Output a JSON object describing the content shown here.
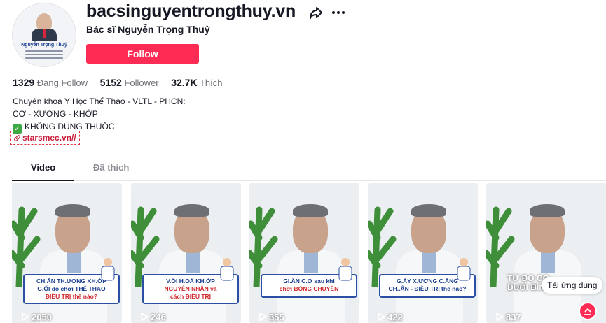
{
  "profile": {
    "username": "bacsinguyentrongthuy.vn",
    "nickname": "Bác sĩ Nguyễn Trọng Thuỷ",
    "follow_label": "Follow",
    "avatar_text": "Nguyễn Trọng Thuỷ"
  },
  "stats": {
    "following_count": "1329",
    "following_label": "Đang Follow",
    "followers_count": "5152",
    "followers_label": "Follower",
    "likes_count": "32.7K",
    "likes_label": "Thích"
  },
  "bio": {
    "line1": "Chuyên khoa Y Học Thể Thao - VLTL - PHCN:",
    "line2": "CƠ - XƯƠNG - KHỚP",
    "line3": "KHÔNG DÙNG THUỐC",
    "link": "starsmec.vn//"
  },
  "tabs": {
    "video": "Video",
    "liked": "Đã thích"
  },
  "videos": [
    {
      "cap1": "CH.ẤN TH.ƯƠNG KH.ỚP",
      "cap2": "G.ỐI do chơi THỂ THAO",
      "cap3": "ĐIỀU TRỊ thế nào?",
      "views": "2050"
    },
    {
      "cap1": "V.ÔI H.OÁ KH.ỚP",
      "cap2": "NGUYÊN NHÂN và",
      "cap3": "cách ĐIỀU TRỊ",
      "views": "246"
    },
    {
      "cap1": "GI.ÃN C.Ơ sau khi",
      "cap2": "chơi BÓNG CHUYỀN",
      "cap3": "",
      "views": "355"
    },
    {
      "cap1": "G.ÃY X.ƯƠNG C.ẲNG",
      "cap2": "CH..ÂN - ĐIỀU TRỊ thế nào?",
      "cap3": "",
      "views": "422"
    },
    {
      "cap1": "TỨ ĐO CO",
      "cap2": "DUỖI BÌNH",
      "cap3": "",
      "views": "837"
    }
  ],
  "overlay": {
    "download_label": "Tải ứng dụng"
  },
  "colors": {
    "accent": "#fe2c55",
    "text": "#161823",
    "muted": "#6f7077",
    "link": "#c91d3a"
  }
}
